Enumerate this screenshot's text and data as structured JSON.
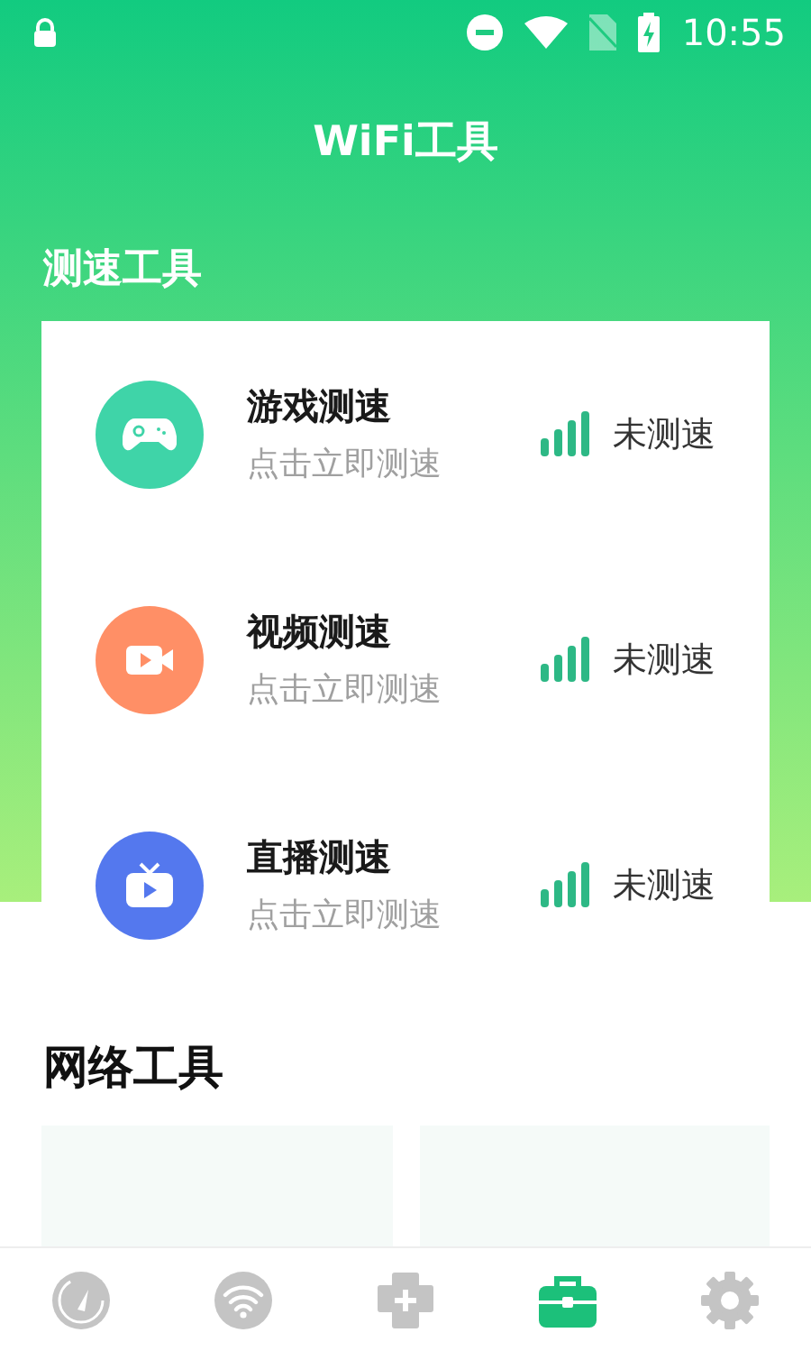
{
  "status_bar": {
    "time": "10:55"
  },
  "header": {
    "title": "WiFi工具"
  },
  "speed_tools": {
    "title": "测速工具",
    "items": [
      {
        "kind": "game",
        "color": "#3fd4a8",
        "name": "游戏测速",
        "hint": "点击立即测速",
        "status": "未测速"
      },
      {
        "kind": "video",
        "color": "#ff8f66",
        "name": "视频测速",
        "hint": "点击立即测速",
        "status": "未测速"
      },
      {
        "kind": "live",
        "color": "#5478ee",
        "name": "直播测速",
        "hint": "点击立即测速",
        "status": "未测速"
      }
    ]
  },
  "network_tools": {
    "title": "网络工具"
  },
  "bottom_nav": [
    {
      "kind": "gauge",
      "selected": false
    },
    {
      "kind": "wifi",
      "selected": false
    },
    {
      "kind": "puzzle",
      "selected": false
    },
    {
      "kind": "toolbox",
      "selected": true
    },
    {
      "kind": "settings",
      "selected": false
    }
  ]
}
